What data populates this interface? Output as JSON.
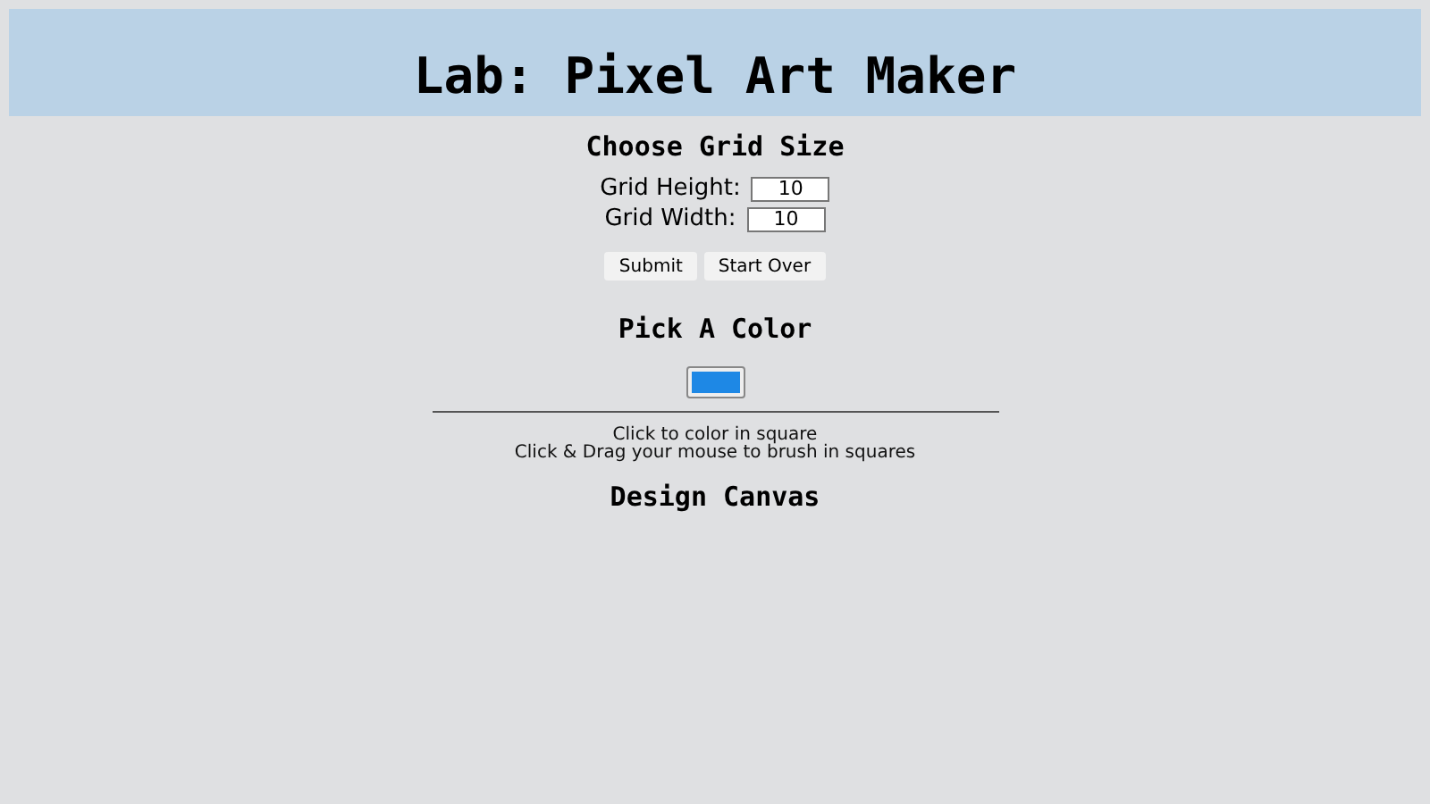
{
  "header": {
    "title": "Lab: Pixel Art Maker"
  },
  "grid_size": {
    "heading": "Choose Grid Size",
    "fields": [
      {
        "label": "Grid Height:",
        "value": "10"
      },
      {
        "label": "Grid Width:",
        "value": "10"
      }
    ],
    "buttons": [
      "Submit",
      "Start Over"
    ]
  },
  "color": {
    "heading": "Pick A Color",
    "picker": {
      "color": "#1e88e5"
    }
  },
  "instructions": [
    "Click to color in square",
    "Click & Drag your mouse to brush in squares"
  ],
  "canvas": {
    "heading": "Design Canvas"
  }
}
